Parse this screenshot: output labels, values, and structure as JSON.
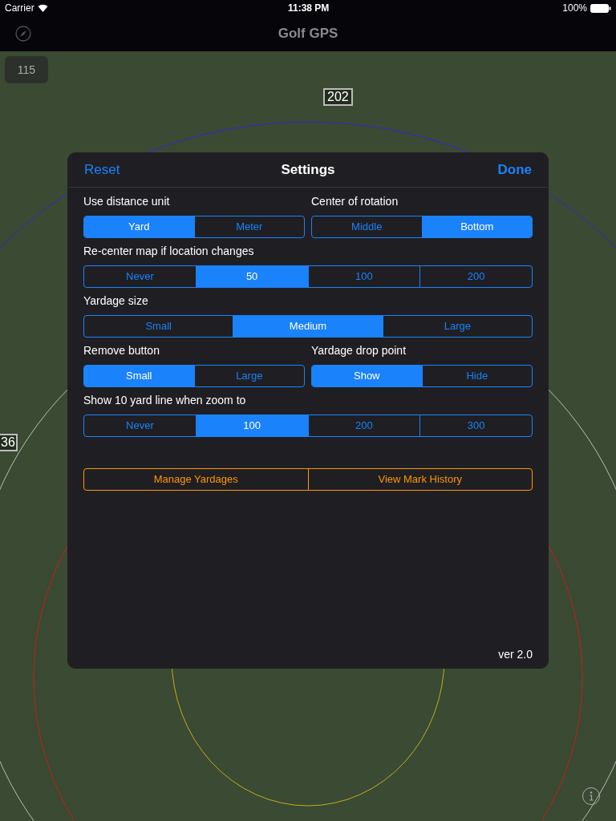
{
  "status_bar": {
    "carrier": "Carrier",
    "time": "11:38 PM",
    "battery": "100%"
  },
  "nav_bar": {
    "title": "Golf GPS"
  },
  "map": {
    "markers": [
      {
        "label": "202"
      },
      {
        "label": "115"
      },
      {
        "label": "36"
      }
    ]
  },
  "settings": {
    "title": "Settings",
    "left_button": "Reset",
    "right_button": "Done",
    "rows": [
      {
        "groups": [
          {
            "label": "Use distance unit",
            "options": [
              {
                "label": "Yard",
                "selected": true
              },
              {
                "label": "Meter",
                "selected": false
              }
            ]
          },
          {
            "label": "Center of rotation",
            "options": [
              {
                "label": "Middle",
                "selected": false
              },
              {
                "label": "Bottom",
                "selected": true
              }
            ]
          }
        ]
      },
      {
        "groups": [
          {
            "label": "Re-center map if location changes",
            "options": [
              {
                "label": "Never",
                "selected": false
              },
              {
                "label": "50",
                "selected": true
              },
              {
                "label": "100",
                "selected": false
              },
              {
                "label": "200",
                "selected": false
              }
            ]
          }
        ]
      },
      {
        "groups": [
          {
            "label": "Yardage size",
            "options": [
              {
                "label": "Small",
                "selected": false
              },
              {
                "label": "Medium",
                "selected": true
              },
              {
                "label": "Large",
                "selected": false
              }
            ]
          }
        ]
      },
      {
        "groups": [
          {
            "label": "Remove button",
            "options": [
              {
                "label": "Small",
                "selected": true
              },
              {
                "label": "Large",
                "selected": false
              }
            ]
          },
          {
            "label": "Yardage drop point",
            "options": [
              {
                "label": "Show",
                "selected": true
              },
              {
                "label": "Hide",
                "selected": false
              }
            ]
          }
        ]
      },
      {
        "groups": [
          {
            "label": "Show 10 yard line when zoom to",
            "options": [
              {
                "label": "Never",
                "selected": false
              },
              {
                "label": "100",
                "selected": true
              },
              {
                "label": "200",
                "selected": false
              },
              {
                "label": "300",
                "selected": false
              }
            ]
          }
        ]
      }
    ],
    "actions": [
      "Manage Yardages",
      "View Mark History"
    ],
    "version": "ver 2.0"
  }
}
